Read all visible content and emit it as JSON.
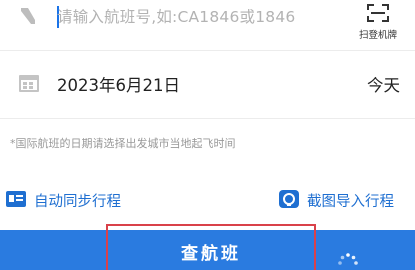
{
  "flight_search": {
    "placeholder": "请输入航班号,如:CA1846或1846",
    "value": "",
    "scan_label": "扫登机牌"
  },
  "date_row": {
    "date": "2023年6月21日",
    "relative_day": "今天"
  },
  "note": "*国际航班的日期请选择出发城市当地起飞时间",
  "actions": {
    "auto_sync": "自动同步行程",
    "screenshot_import": "截图导入行程"
  },
  "search_button": {
    "label": "查航班"
  },
  "colors": {
    "accent": "#1f6fd1",
    "button_bg": "#2a7be0",
    "highlight_border": "#d9414a",
    "placeholder": "#b3b3b3",
    "note": "#999999"
  },
  "icons": {
    "flight": "plane-icon",
    "scan": "scan-icon",
    "date": "calendar-icon",
    "auto_sync": "id-card-icon",
    "screenshot_import": "screenshot-icon",
    "loading": "loading-icon"
  }
}
